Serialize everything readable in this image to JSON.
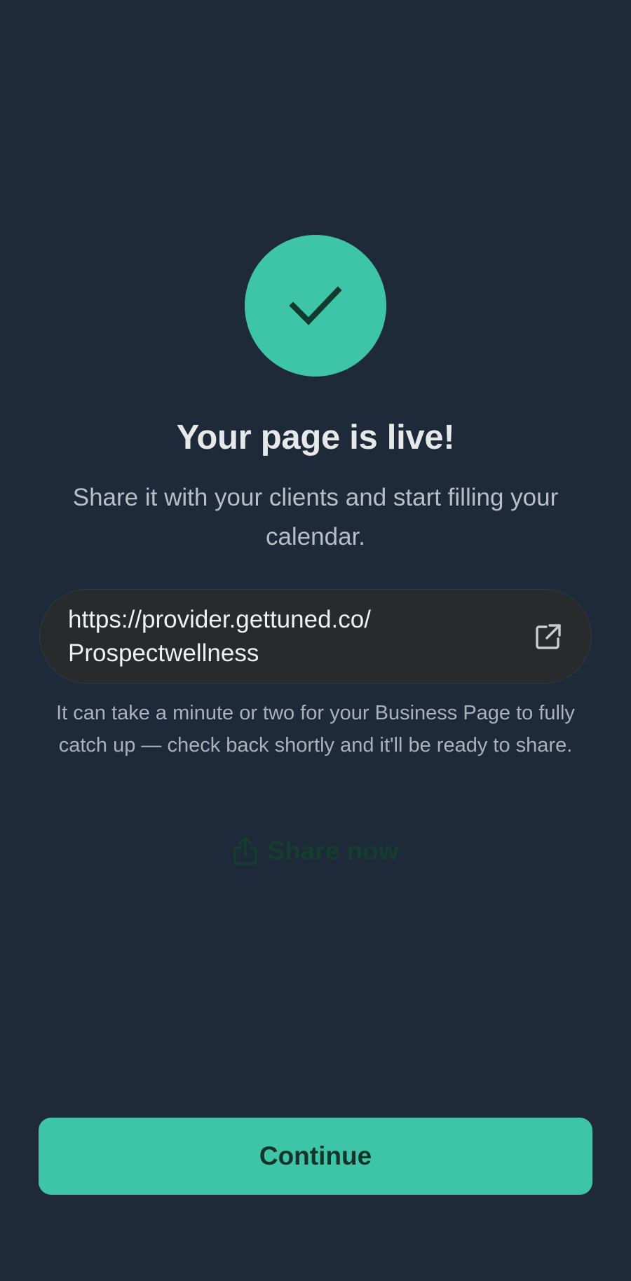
{
  "success": {
    "icon": "checkmark-icon",
    "circle_color": "#3ec4a6",
    "check_color": "#0f3a2c"
  },
  "header": {
    "title": "Your page is live!",
    "subtitle": "Share it with your clients and start filling your calendar."
  },
  "url_box": {
    "url_line1": "https://provider.gettuned.co/",
    "url_line2": "Prospectwellness",
    "open_icon": "external-link-icon"
  },
  "note": "It can take a minute or two for your Business Page to fully catch up — check back shortly and it'll be ready to share.",
  "share": {
    "label": "Share now",
    "icon": "share-icon",
    "color": "#143e2e"
  },
  "actions": {
    "continue_label": "Continue",
    "accent_color": "#3ec4a6"
  },
  "theme": {
    "background": "#1e2939"
  }
}
